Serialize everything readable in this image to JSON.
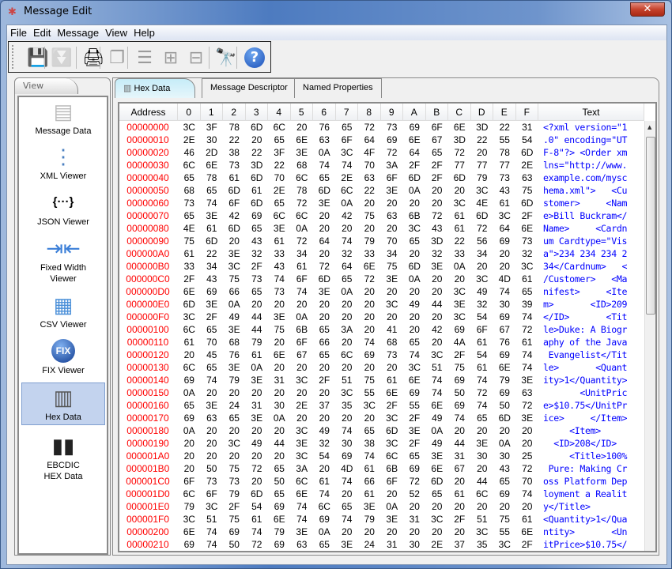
{
  "window": {
    "title": "Message Edit",
    "close_label": "✕"
  },
  "menu": [
    "File",
    "Edit",
    "Message",
    "View",
    "Help"
  ],
  "toolbar": [
    {
      "name": "save-icon",
      "glyph": "💾",
      "enabled": true
    },
    {
      "name": "download-icon",
      "glyph": "⏬",
      "enabled": false
    },
    {
      "name": "print-icon",
      "glyph": "🖨",
      "enabled": true
    },
    {
      "name": "copy-icon",
      "glyph": "❐",
      "enabled": false
    },
    {
      "name": "align-icon",
      "glyph": "☰",
      "enabled": false
    },
    {
      "name": "add-to-icon",
      "glyph": "⊞",
      "enabled": false
    },
    {
      "name": "remove-from-icon",
      "glyph": "⊟",
      "enabled": false
    },
    {
      "name": "binoculars-icon",
      "glyph": "🔭",
      "enabled": true
    },
    {
      "name": "help-icon",
      "glyph": "?",
      "enabled": true
    }
  ],
  "sidebar": {
    "tab": "View",
    "items": [
      {
        "label": "Message Data",
        "icon": "message-data-icon",
        "glyph": "▤",
        "color": "#bbbbbb"
      },
      {
        "label": "XML Viewer",
        "icon": "xml-tree-icon",
        "glyph": "⋮",
        "color": "#4a7fc0"
      },
      {
        "label": "JSON Viewer",
        "icon": "json-braces-icon",
        "glyph": "{···}",
        "color": "#000000"
      },
      {
        "label": "Fixed Width\nViewer",
        "icon": "fixed-width-icon",
        "glyph": "⇥⇤",
        "color": "#3b7fd8"
      },
      {
        "label": "CSV Viewer",
        "icon": "csv-grid-icon",
        "glyph": "▦",
        "color": "#4a8fd8"
      },
      {
        "label": "FIX Viewer",
        "icon": "fix-globe-icon",
        "glyph": "FIX",
        "color": "#1d4fa8"
      },
      {
        "label": "Hex Data",
        "icon": "hex-data-icon",
        "glyph": "▥",
        "color": "#555555",
        "selected": true
      },
      {
        "label": "EBCDIC\nHEX Data",
        "icon": "ebcdic-server-icon",
        "glyph": "▮▮",
        "color": "#222222"
      }
    ]
  },
  "tabs": [
    {
      "label": "Hex Data",
      "active": true
    },
    {
      "label": "Message Descriptor"
    },
    {
      "label": "Named Properties"
    }
  ],
  "table": {
    "headers": [
      "Address",
      "0",
      "1",
      "2",
      "3",
      "4",
      "5",
      "6",
      "7",
      "8",
      "9",
      "A",
      "B",
      "C",
      "D",
      "E",
      "F",
      "Text"
    ],
    "rows": [
      {
        "addr": "00000000",
        "bytes": "3C 3F 78 6D 6C 20 76 65 72 73 69 6F 6E 3D 22 31",
        "text": "<?xml version=\"1"
      },
      {
        "addr": "00000010",
        "bytes": "2E 30 22 20 65 6E 63 6F 64 69 6E 67 3D 22 55 54",
        "text": ".0\" encoding=\"UT"
      },
      {
        "addr": "00000020",
        "bytes": "46 2D 38 22 3F 3E 0A 3C 4F 72 64 65 72 20 78 6D",
        "text": "F-8\"?> <Order xm"
      },
      {
        "addr": "00000030",
        "bytes": "6C 6E 73 3D 22 68 74 74 70 3A 2F 2F 77 77 77 2E",
        "text": "lns=\"http://www."
      },
      {
        "addr": "00000040",
        "bytes": "65 78 61 6D 70 6C 65 2E 63 6F 6D 2F 6D 79 73 63",
        "text": "example.com/mysc"
      },
      {
        "addr": "00000050",
        "bytes": "68 65 6D 61 2E 78 6D 6C 22 3E 0A 20 20 3C 43 75",
        "text": "hema.xml\">   <Cu"
      },
      {
        "addr": "00000060",
        "bytes": "73 74 6F 6D 65 72 3E 0A 20 20 20 20 3C 4E 61 6D",
        "text": "stomer>     <Nam"
      },
      {
        "addr": "00000070",
        "bytes": "65 3E 42 69 6C 6C 20 42 75 63 6B 72 61 6D 3C 2F",
        "text": "e>Bill Buckram</"
      },
      {
        "addr": "00000080",
        "bytes": "4E 61 6D 65 3E 0A 20 20 20 20 3C 43 61 72 64 6E",
        "text": "Name>     <Cardn"
      },
      {
        "addr": "00000090",
        "bytes": "75 6D 20 43 61 72 64 74 79 70 65 3D 22 56 69 73",
        "text": "um Cardtype=\"Vis"
      },
      {
        "addr": "000000A0",
        "bytes": "61 22 3E 32 33 34 20 32 33 34 20 32 33 34 20 32",
        "text": "a\">234 234 234 2"
      },
      {
        "addr": "000000B0",
        "bytes": "33 34 3C 2F 43 61 72 64 6E 75 6D 3E 0A 20 20 3C",
        "text": "34</Cardnum>   <"
      },
      {
        "addr": "000000C0",
        "bytes": "2F 43 75 73 74 6F 6D 65 72 3E 0A 20 20 3C 4D 61",
        "text": "/Customer>   <Ma"
      },
      {
        "addr": "000000D0",
        "bytes": "6E 69 66 65 73 74 3E 0A 20 20 20 20 3C 49 74 65",
        "text": "nifest>     <Ite"
      },
      {
        "addr": "000000E0",
        "bytes": "6D 3E 0A 20 20 20 20 20 20 3C 49 44 3E 32 30 39",
        "text": "m>       <ID>209"
      },
      {
        "addr": "000000F0",
        "bytes": "3C 2F 49 44 3E 0A 20 20 20 20 20 20 3C 54 69 74",
        "text": "</ID>       <Tit"
      },
      {
        "addr": "00000100",
        "bytes": "6C 65 3E 44 75 6B 65 3A 20 41 20 42 69 6F 67 72",
        "text": "le>Duke: A Biogr"
      },
      {
        "addr": "00000110",
        "bytes": "61 70 68 79 20 6F 66 20 74 68 65 20 4A 61 76 61",
        "text": "aphy of the Java"
      },
      {
        "addr": "00000120",
        "bytes": "20 45 76 61 6E 67 65 6C 69 73 74 3C 2F 54 69 74",
        "text": " Evangelist</Tit"
      },
      {
        "addr": "00000130",
        "bytes": "6C 65 3E 0A 20 20 20 20 20 20 3C 51 75 61 6E 74",
        "text": "le>       <Quant"
      },
      {
        "addr": "00000140",
        "bytes": "69 74 79 3E 31 3C 2F 51 75 61 6E 74 69 74 79 3E",
        "text": "ity>1</Quantity>"
      },
      {
        "addr": "00000150",
        "bytes": "0A 20 20 20 20 20 20 3C 55 6E 69 74 50 72 69 63",
        "text": "       <UnitPric"
      },
      {
        "addr": "00000160",
        "bytes": "65 3E 24 31 30 2E 37 35 3C 2F 55 6E 69 74 50 72",
        "text": "e>$10.75</UnitPr"
      },
      {
        "addr": "00000170",
        "bytes": "69 63 65 3E 0A 20 20 20 20 3C 2F 49 74 65 6D 3E",
        "text": "ice>     </Item>"
      },
      {
        "addr": "00000180",
        "bytes": "0A 20 20 20 20 3C 49 74 65 6D 3E 0A 20 20 20 20",
        "text": "     <Item>     "
      },
      {
        "addr": "00000190",
        "bytes": "20 20 3C 49 44 3E 32 30 38 3C 2F 49 44 3E 0A 20",
        "text": "  <ID>208</ID>  "
      },
      {
        "addr": "000001A0",
        "bytes": "20 20 20 20 20 3C 54 69 74 6C 65 3E 31 30 30 25",
        "text": "     <Title>100%"
      },
      {
        "addr": "000001B0",
        "bytes": "20 50 75 72 65 3A 20 4D 61 6B 69 6E 67 20 43 72",
        "text": " Pure: Making Cr"
      },
      {
        "addr": "000001C0",
        "bytes": "6F 73 73 20 50 6C 61 74 66 6F 72 6D 20 44 65 70",
        "text": "oss Platform Dep"
      },
      {
        "addr": "000001D0",
        "bytes": "6C 6F 79 6D 65 6E 74 20 61 20 52 65 61 6C 69 74",
        "text": "loyment a Realit"
      },
      {
        "addr": "000001E0",
        "bytes": "79 3C 2F 54 69 74 6C 65 3E 0A 20 20 20 20 20 20",
        "text": "y</Title>       "
      },
      {
        "addr": "000001F0",
        "bytes": "3C 51 75 61 6E 74 69 74 79 3E 31 3C 2F 51 75 61",
        "text": "<Quantity>1</Qua"
      },
      {
        "addr": "00000200",
        "bytes": "6E 74 69 74 79 3E 0A 20 20 20 20 20 20 3C 55 6E",
        "text": "ntity>       <Un"
      },
      {
        "addr": "00000210",
        "bytes": "69 74 50 72 69 63 65 3E 24 31 30 2E 37 35 3C 2F",
        "text": "itPrice>$10.75</"
      }
    ]
  },
  "colors": {
    "address": "#ff0000",
    "text_column": "#0000ff",
    "selection": "#c3d3ee"
  }
}
